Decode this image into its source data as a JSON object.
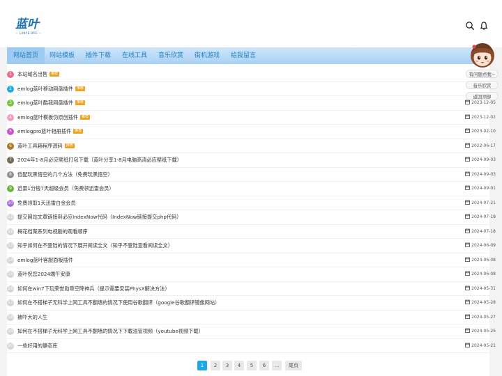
{
  "logo": {
    "main": "蓝叶",
    "sub": "— LANYE.ORG —"
  },
  "colors": {
    "accent": "#1ea7e8",
    "nav_text": "#1e7fc8",
    "badge": "#f0a21f",
    "brand": "#1d6fb8"
  },
  "header": {
    "search_icon": "search-icon",
    "bell_icon": "bell-icon"
  },
  "nav": [
    "网站首页",
    "网站模板",
    "插件下载",
    "在线工具",
    "音乐欣赏",
    "街机游戏",
    "给我留言"
  ],
  "sidebar_buttons": [
    "有问题点我~",
    "音乐欣赏",
    "返回顶部"
  ],
  "list": [
    {
      "num": "1",
      "title": "本站域名出售",
      "badge": "推荐",
      "date": ""
    },
    {
      "num": "2",
      "title": "emlog蓝叶移动网盘插件",
      "badge": "推荐",
      "date": ""
    },
    {
      "num": "3",
      "title": "emlog蓝叶酷我网盘插件",
      "badge": "推荐",
      "date": "2023-12-05"
    },
    {
      "num": "4",
      "title": "emlog蓝叶模板伪原创插件",
      "badge": "推荐",
      "date": "2023-12-02"
    },
    {
      "num": "5",
      "title": "emlogpro蓝叶相册插件",
      "badge": "推荐",
      "date": "2023-02-10"
    },
    {
      "num": "6",
      "title": "蓝叶工具箱程序源码",
      "badge": "推荐",
      "date": "2022-06-17"
    },
    {
      "num": "7",
      "title": "2024年1-8月必应壁纸打包下载（蓝叶分享1-8月电脑高清必应壁纸下载）",
      "badge": "",
      "date": "2024-09-03"
    },
    {
      "num": "8",
      "title": "低配玩黑悟空的几个方法（免费玩黑悟空）",
      "badge": "",
      "date": "2024-09-03"
    },
    {
      "num": "9",
      "title": "迅雷1分钱7天超级会员（免费领迅雷会员）",
      "badge": "",
      "date": "2024-09-01"
    },
    {
      "num": "10",
      "title": "免费领取1天迅雷白金会员",
      "badge": "",
      "date": "2024-07-21"
    },
    {
      "num": "11",
      "title": "提交网站文章链接到必应IndexNow代码（IndexNow链接提交php代码）",
      "badge": "",
      "date": "2024-07-18"
    },
    {
      "num": "12",
      "title": "梅花档案系列电视剧的观看顺序",
      "badge": "",
      "date": "2024-07-18"
    },
    {
      "num": "13",
      "title": "知乎如何在不登陆的情况下展开阅读全文（知乎不登陆查看阅读全文）",
      "badge": "",
      "date": "2024-06-09"
    },
    {
      "num": "14",
      "title": "emlog蓝叶客服面板插件",
      "badge": "",
      "date": "2024-06-08"
    },
    {
      "num": "15",
      "title": "蓝叶祝您2024端午安康",
      "badge": "",
      "date": "2024-06-08"
    },
    {
      "num": "16",
      "title": "如何在win7下玩荣誉勋章空降神兵（提示需要安装PhysX解决方法）",
      "badge": "",
      "date": "2024-05-31"
    },
    {
      "num": "17",
      "title": "如何在不搭梯子无科学上网工具不翻墙的情况下使用谷歌翻译（google谷歌翻译镜像网站）",
      "badge": "",
      "date": "2024-05-28"
    },
    {
      "num": "18",
      "title": "被吓大的人生",
      "badge": "",
      "date": "2024-05-27"
    },
    {
      "num": "19",
      "title": "如何在不搭梯子无科学上网工具不翻墙的情况下下载油管视频（youtube视频下载）",
      "badge": "",
      "date": "2024-05-25"
    },
    {
      "num": "20",
      "title": "一些好用的静态库",
      "badge": "",
      "date": "2024-05-21"
    }
  ],
  "rank_colors": [
    "#e86e8c",
    "#1ea7e8",
    "#7bc142",
    "#f29bc4",
    "#c653c8",
    "#a8782a",
    "#7a6a5a",
    "#8e8e8e",
    "#6ab33a",
    "#a86ad8"
  ],
  "rank_default_color": "#d5d5d5",
  "pagination": [
    "1",
    "2",
    "3",
    "4",
    "5",
    "6",
    "...",
    "尾页"
  ],
  "pagination_active": "1"
}
